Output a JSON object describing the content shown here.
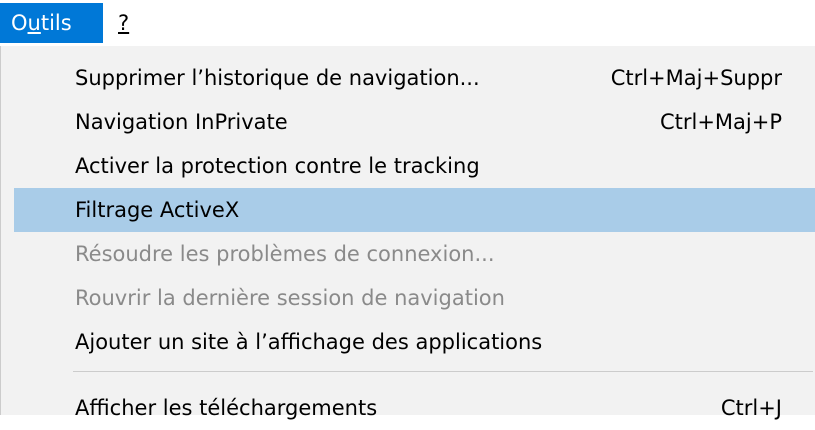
{
  "menubar": {
    "outils": {
      "label_mnemonic": "u",
      "label_prefix": "O",
      "label_suffix": "tils"
    },
    "help": {
      "label": "?"
    }
  },
  "colors": {
    "menubar_active": "#0078d7",
    "highlight": "#a9cce8",
    "menu_background": "#f2f2f2",
    "disabled_text": "#8a8a8a"
  },
  "menu_items": [
    {
      "label": "Supprimer l’historique de navigation...",
      "shortcut": "Ctrl+Maj+Suppr",
      "enabled": true,
      "highlighted": false
    },
    {
      "label": "Navigation InPrivate",
      "shortcut": "Ctrl+Maj+P",
      "enabled": true,
      "highlighted": false
    },
    {
      "label": "Activer la protection contre le tracking",
      "shortcut": "",
      "enabled": true,
      "highlighted": false
    },
    {
      "label": "Filtrage ActiveX",
      "shortcut": "",
      "enabled": true,
      "highlighted": true
    },
    {
      "label": "Résoudre les problèmes de connexion...",
      "shortcut": "",
      "enabled": false,
      "highlighted": false
    },
    {
      "label": "Rouvrir la dernière session de navigation",
      "shortcut": "",
      "enabled": false,
      "highlighted": false
    },
    {
      "label": "Ajouter un site à l’affichage des applications",
      "shortcut": "",
      "enabled": true,
      "highlighted": false
    },
    {
      "label": "Afficher les téléchargements",
      "shortcut": "Ctrl+J",
      "enabled": true,
      "highlighted": false
    }
  ]
}
